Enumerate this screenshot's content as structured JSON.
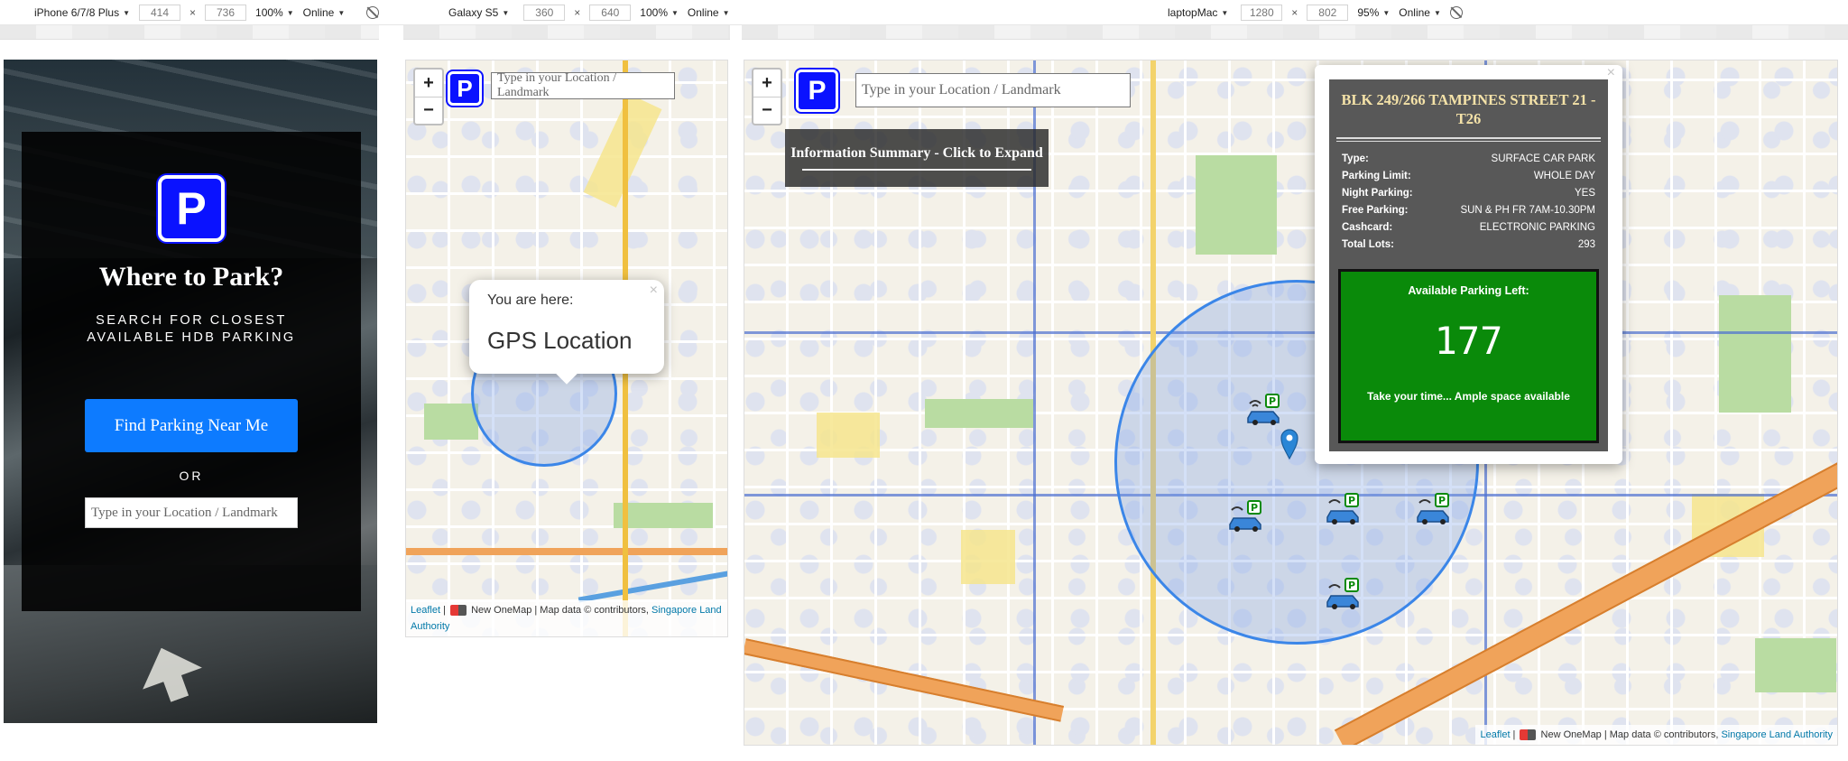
{
  "toolbar": {
    "devices": [
      {
        "name": "iPhone 6/7/8 Plus",
        "width": "414",
        "height": "736",
        "zoom": "100%",
        "network": "Online"
      },
      {
        "name": "Galaxy S5",
        "width": "360",
        "height": "640",
        "zoom": "100%",
        "network": "Online"
      },
      {
        "name": "laptopMac",
        "width": "1280",
        "height": "802",
        "zoom": "95%",
        "network": "Online"
      }
    ],
    "times_symbol": "×"
  },
  "landing": {
    "logo_letter": "P",
    "title": "Where to Park?",
    "subtitle": "SEARCH FOR CLOSEST AVAILABLE HDB PARKING",
    "find_button": "Find Parking Near Me",
    "or_text": "OR",
    "search_placeholder": "Type in your Location / Landmark"
  },
  "map_small": {
    "zoom_in": "+",
    "zoom_out": "−",
    "logo_letter": "P",
    "search_placeholder": "Type in your Location / Landmark",
    "popup_heading": "You are here:",
    "popup_text": "GPS Location",
    "popup_close": "×",
    "attribution": {
      "leaflet": "Leaflet",
      "sep": " | ",
      "onemap": "New OneMap | Map data © contributors,",
      "sla": "Singapore Land Authority"
    }
  },
  "map_large": {
    "zoom_in": "+",
    "zoom_out": "−",
    "logo_letter": "P",
    "search_placeholder": "Type in your Location / Landmark",
    "info_summary": "Information Summary - Click to Expand",
    "popup_close": "×",
    "carpark": {
      "title": "BLK 249/266 TAMPINES STREET 21 - T26",
      "rows": [
        {
          "label": "Type:",
          "value": "SURFACE CAR PARK"
        },
        {
          "label": "Parking Limit:",
          "value": "WHOLE DAY"
        },
        {
          "label": "Night Parking:",
          "value": "YES"
        },
        {
          "label": "Free Parking:",
          "value": "SUN & PH FR 7AM-10.30PM"
        },
        {
          "label": "Cashcard:",
          "value": "ELECTRONIC PARKING"
        },
        {
          "label": "Total Lots:",
          "value": "293"
        }
      ],
      "available_label": "Available Parking Left:",
      "available_count": "177",
      "available_message": "Take your time... Ample space available"
    },
    "attribution": {
      "leaflet": "Leaflet",
      "sep": " | ",
      "onemap": "New OneMap | Map data © contributors,",
      "sla": "Singapore Land Authority"
    }
  },
  "colors": {
    "brand_blue": "#0a12ff",
    "button_blue": "#0d7bff",
    "available_green": "#0a8a0a",
    "gold_title": "#f4e2a8"
  },
  "icons": [
    "dropdown-caret-icon",
    "rotate-icon",
    "parking-logo-icon",
    "car-wifi-parking-marker-icon",
    "location-pin-icon"
  ]
}
